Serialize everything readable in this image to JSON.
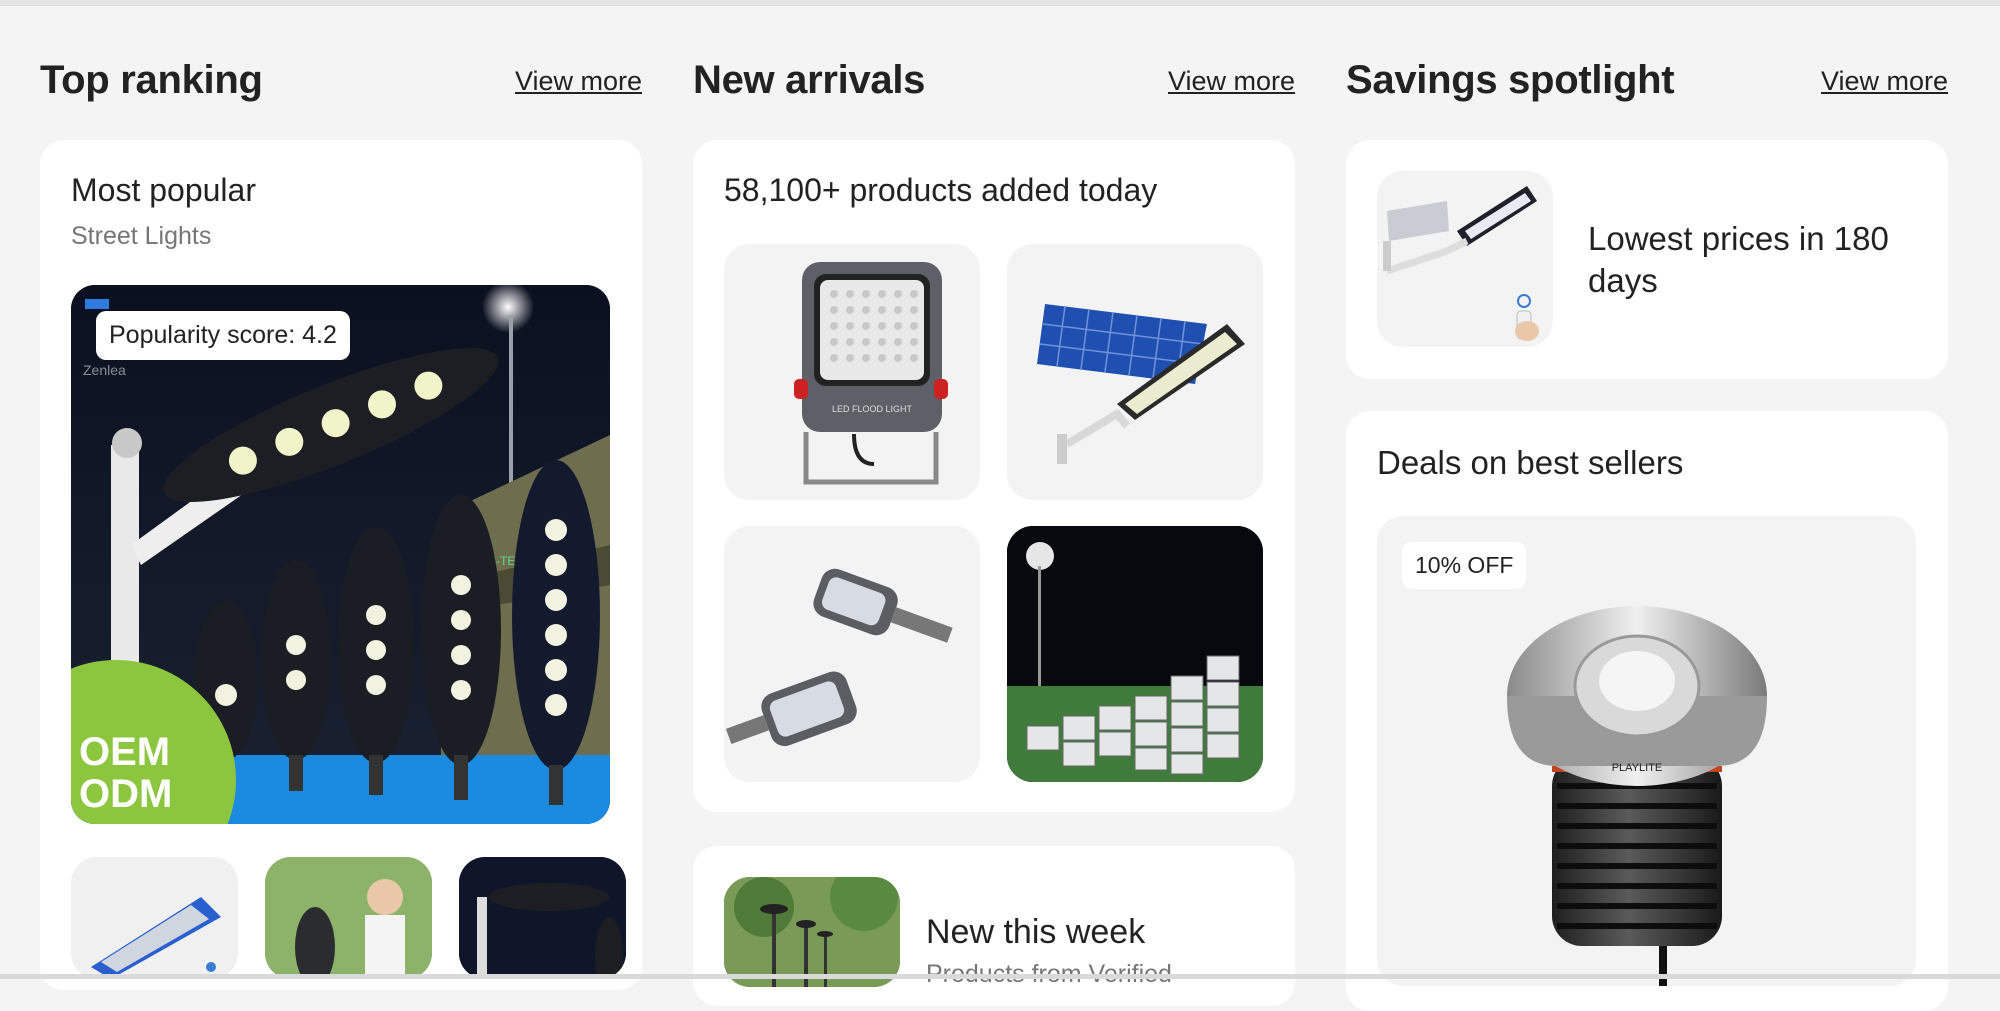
{
  "columns": {
    "top_ranking": {
      "title": "Top ranking",
      "view_more": "View more",
      "card_title": "Most popular",
      "card_subtitle": "Street Lights",
      "popularity_badge": "Popularity score: 4.2",
      "hero_text": "OEM\nODM",
      "hero_logo_text": "Zenlea"
    },
    "new_arrivals": {
      "title": "New arrivals",
      "view_more": "View more",
      "card_title": "58,100+ products added today",
      "flood_label": "LED FLOOD LIGHT",
      "week_title": "New this week",
      "week_subtitle": "Products from Verified"
    },
    "savings_spotlight": {
      "title": "Savings spotlight",
      "view_more": "View more",
      "lowest_prices": "Lowest prices in 180 days",
      "deals_title": "Deals on best sellers",
      "discount_badge": "10% OFF",
      "product_brand": "PLAYLITE"
    }
  },
  "colors": {
    "page_bg": "#f4f4f4",
    "card_bg": "#ffffff",
    "tile_bg": "#f3f3f3",
    "text": "#222222",
    "muted": "#767676",
    "oem_green": "#8cc63f"
  }
}
